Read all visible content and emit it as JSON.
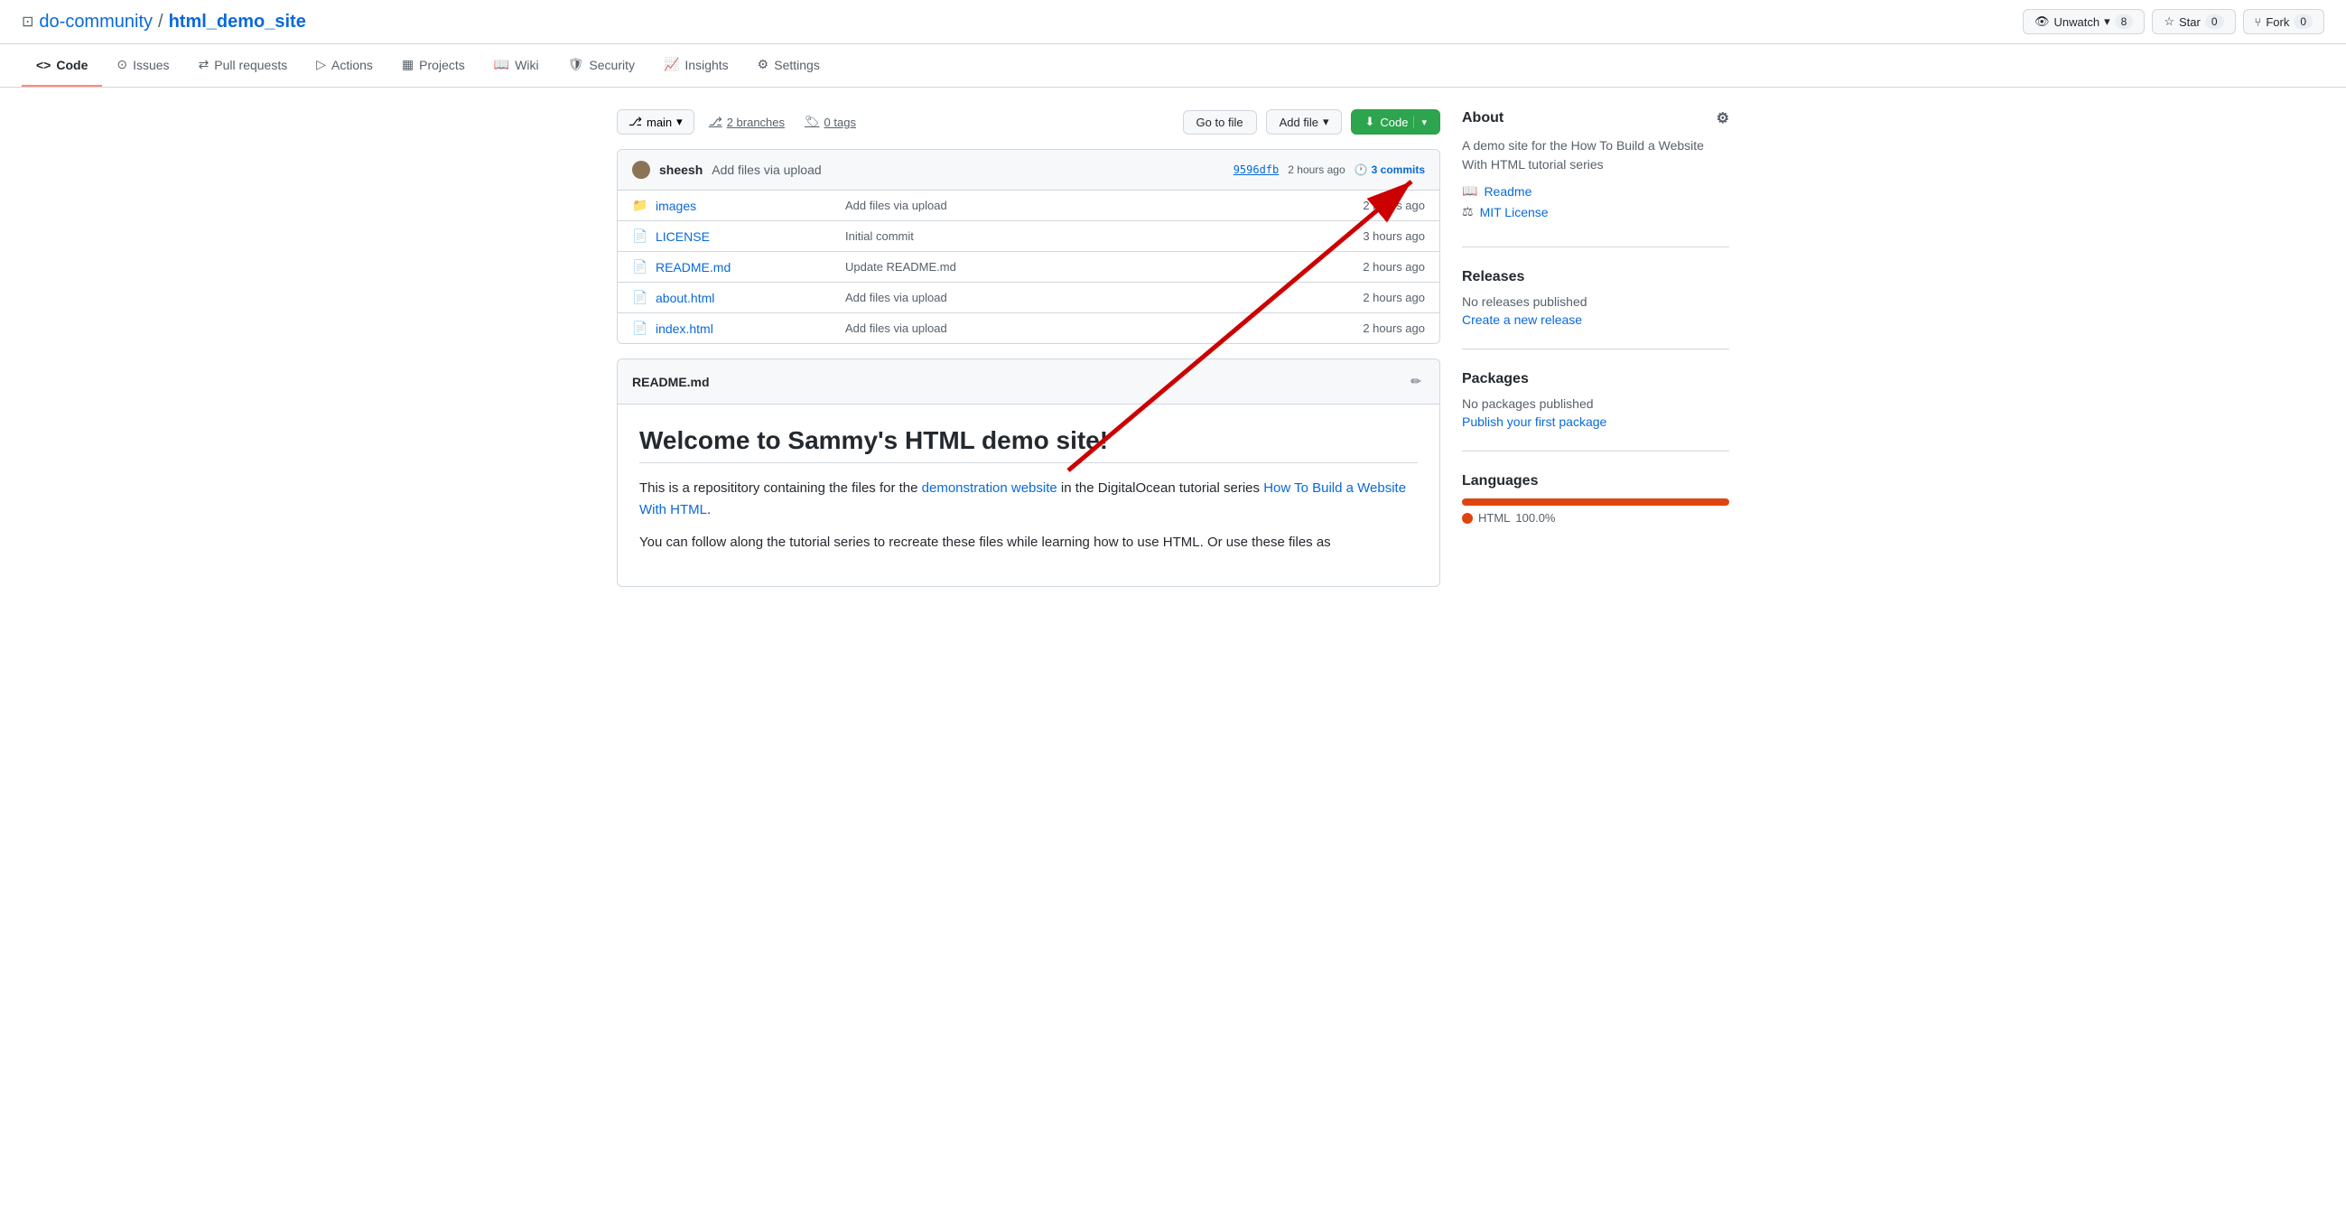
{
  "topbar": {
    "repo_icon": "⊡",
    "org_name": "do-community",
    "separator": "/",
    "repo_name": "html_demo_site",
    "actions": {
      "unwatch": {
        "label": "Unwatch",
        "icon": "👁",
        "count": "8"
      },
      "star": {
        "label": "Star",
        "icon": "☆",
        "count": "0"
      },
      "fork": {
        "label": "Fork",
        "icon": "⑂",
        "count": "0"
      }
    }
  },
  "nav": {
    "tabs": [
      {
        "id": "code",
        "label": "Code",
        "icon": "<>",
        "active": true
      },
      {
        "id": "issues",
        "label": "Issues",
        "icon": "ⓘ",
        "active": false
      },
      {
        "id": "pull-requests",
        "label": "Pull requests",
        "icon": "⇄",
        "active": false
      },
      {
        "id": "actions",
        "label": "Actions",
        "icon": "▷",
        "active": false
      },
      {
        "id": "projects",
        "label": "Projects",
        "icon": "▦",
        "active": false
      },
      {
        "id": "wiki",
        "label": "Wiki",
        "icon": "📖",
        "active": false
      },
      {
        "id": "security",
        "label": "Security",
        "icon": "🛡",
        "active": false
      },
      {
        "id": "insights",
        "label": "Insights",
        "icon": "📈",
        "active": false
      },
      {
        "id": "settings",
        "label": "Settings",
        "icon": "⚙",
        "active": false
      }
    ]
  },
  "toolbar": {
    "branch": "main",
    "branches_count": "2 branches",
    "tags_count": "0 tags",
    "goto_file_label": "Go to file",
    "add_file_label": "Add file",
    "code_label": "Code"
  },
  "commit_row": {
    "author": "sheesh",
    "message": "Add files via upload",
    "hash": "9596dfb",
    "time": "2 hours ago",
    "commits_count": "3",
    "commits_label": "commits"
  },
  "files": [
    {
      "name": "images",
      "type": "folder",
      "commit": "Add files via upload",
      "time": "2 hours ago"
    },
    {
      "name": "LICENSE",
      "type": "file",
      "commit": "Initial commit",
      "time": "3 hours ago"
    },
    {
      "name": "README.md",
      "type": "file",
      "commit": "Update README.md",
      "time": "2 hours ago"
    },
    {
      "name": "about.html",
      "type": "file",
      "commit": "Add files via upload",
      "time": "2 hours ago"
    },
    {
      "name": "index.html",
      "type": "file",
      "commit": "Add files via upload",
      "time": "2 hours ago"
    }
  ],
  "readme": {
    "title": "README.md",
    "heading": "Welcome to Sammy's HTML demo site!",
    "paragraph1_start": "This is a reposititory containing the files for the ",
    "demo_link_text": "demonstration website",
    "paragraph1_mid": " in the DigitalOcean tutorial series ",
    "series_link_text": "How To Build a Website With HTML",
    "paragraph1_end": ".",
    "paragraph2": "You can follow along the tutorial series to recreate these files while learning how to use HTML. Or use these files as"
  },
  "sidebar": {
    "about_title": "About",
    "gear_icon": "⚙",
    "description": "A demo site for the How To Build a Website With HTML tutorial series",
    "readme_label": "Readme",
    "license_label": "MIT License",
    "releases_title": "Releases",
    "no_releases": "No releases published",
    "create_release": "Create a new release",
    "packages_title": "Packages",
    "no_packages": "No packages published",
    "publish_package": "Publish your first package",
    "languages_title": "Languages",
    "html_label": "HTML",
    "html_percent": "100.0%"
  }
}
